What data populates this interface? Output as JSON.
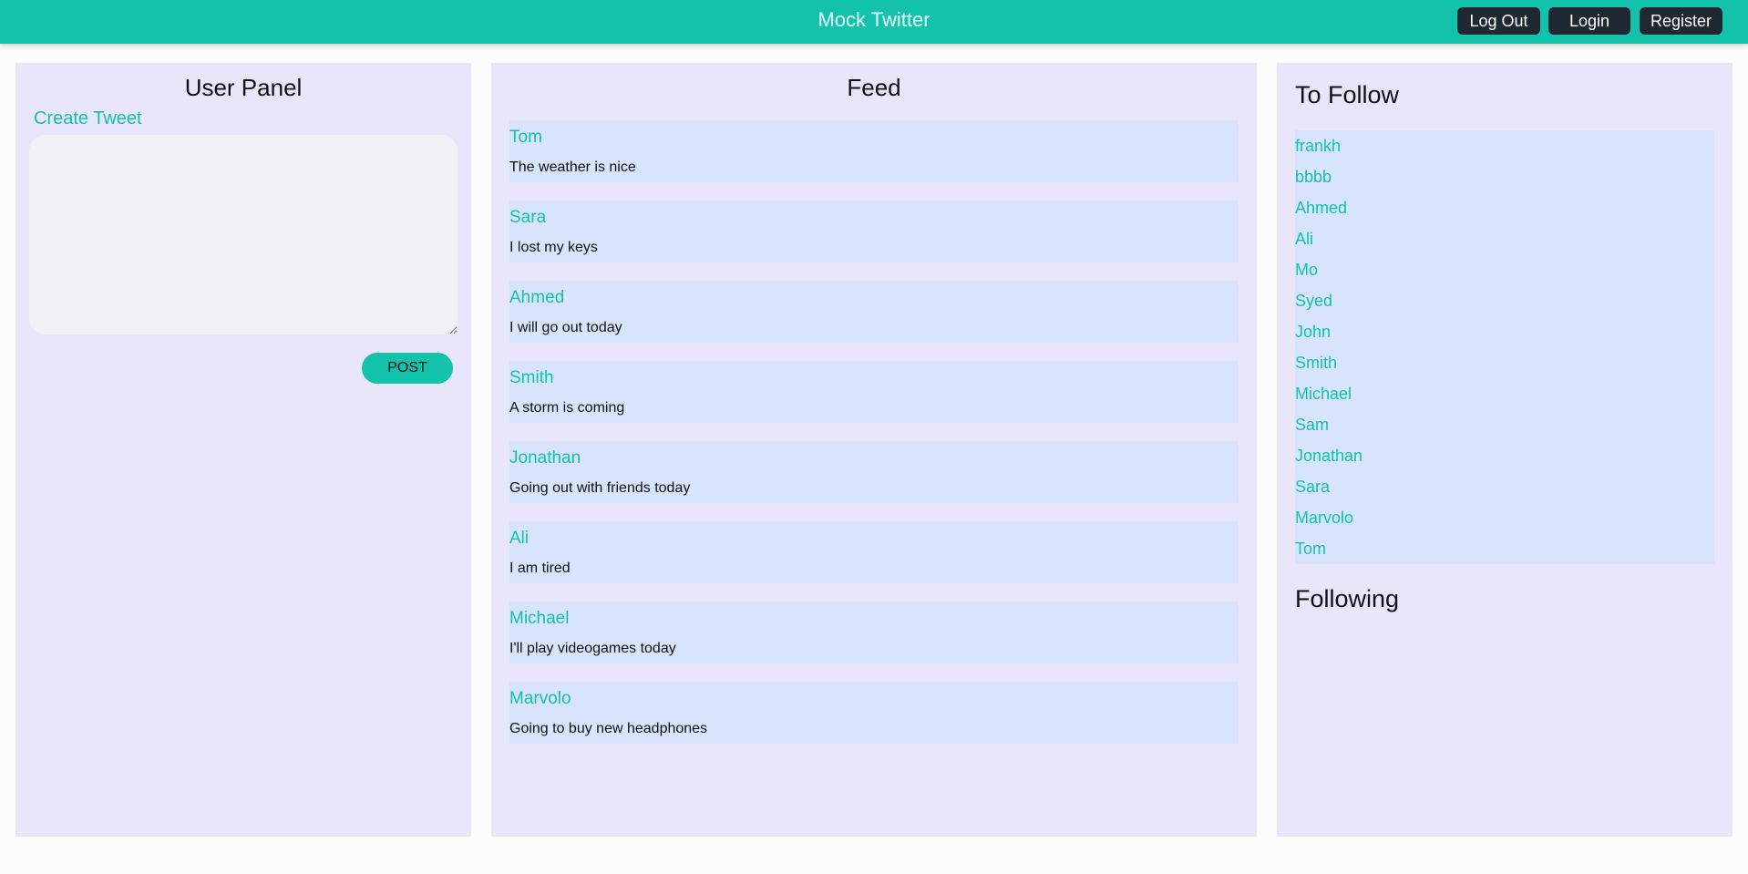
{
  "header": {
    "brand": "Mock Twitter",
    "logout_label": "Log Out",
    "login_label": "Login",
    "register_label": "Register"
  },
  "user_panel": {
    "title": "User Panel",
    "create_tweet_label": "Create Tweet",
    "textarea_value": "",
    "post_label": "POST"
  },
  "feed": {
    "title": "Feed",
    "tweets": [
      {
        "user": "Tom",
        "text": "The weather is nice"
      },
      {
        "user": "Sara",
        "text": "I lost my keys"
      },
      {
        "user": "Ahmed",
        "text": "I will go out today"
      },
      {
        "user": "Smith",
        "text": "A storm is coming"
      },
      {
        "user": "Jonathan",
        "text": "Going out with friends today"
      },
      {
        "user": "Ali",
        "text": "I am tired"
      },
      {
        "user": "Michael",
        "text": "I'll play videogames today"
      },
      {
        "user": "Marvolo",
        "text": "Going to buy new headphones"
      }
    ]
  },
  "follow_panel": {
    "to_follow_title": "To Follow",
    "to_follow": [
      "frankh",
      "bbbb",
      "Ahmed",
      "Ali",
      "Mo",
      "Syed",
      "John",
      "Smith",
      "Michael",
      "Sam",
      "Jonathan",
      "Sara",
      "Marvolo",
      "Tom"
    ],
    "following_title": "Following"
  },
  "colors": {
    "accent": "#13c2ab",
    "panel_bg": "#e9e5fb",
    "card_bg": "#d7e4fb",
    "button_dark": "#1f2732"
  }
}
